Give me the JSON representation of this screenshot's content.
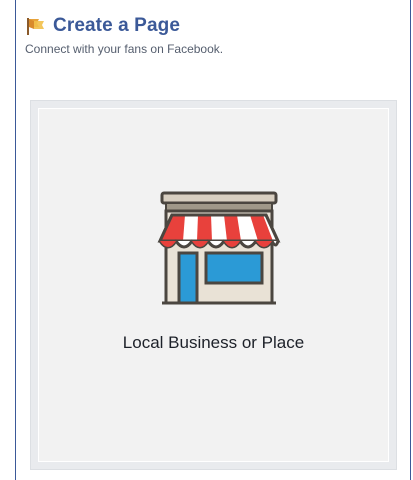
{
  "header": {
    "title": "Create a Page",
    "subtitle": "Connect with your fans on Facebook.",
    "icon": "flag-icon"
  },
  "categories": [
    {
      "label": "Local Business or Place",
      "icon": "storefront-icon"
    }
  ],
  "colors": {
    "title": "#3b5998",
    "frame_border": "#3b5998",
    "tile_background": "#f2f2f2",
    "awning_red": "#e8413c",
    "awning_white": "#ffffff",
    "storefront_blue": "#2b9ad6"
  }
}
